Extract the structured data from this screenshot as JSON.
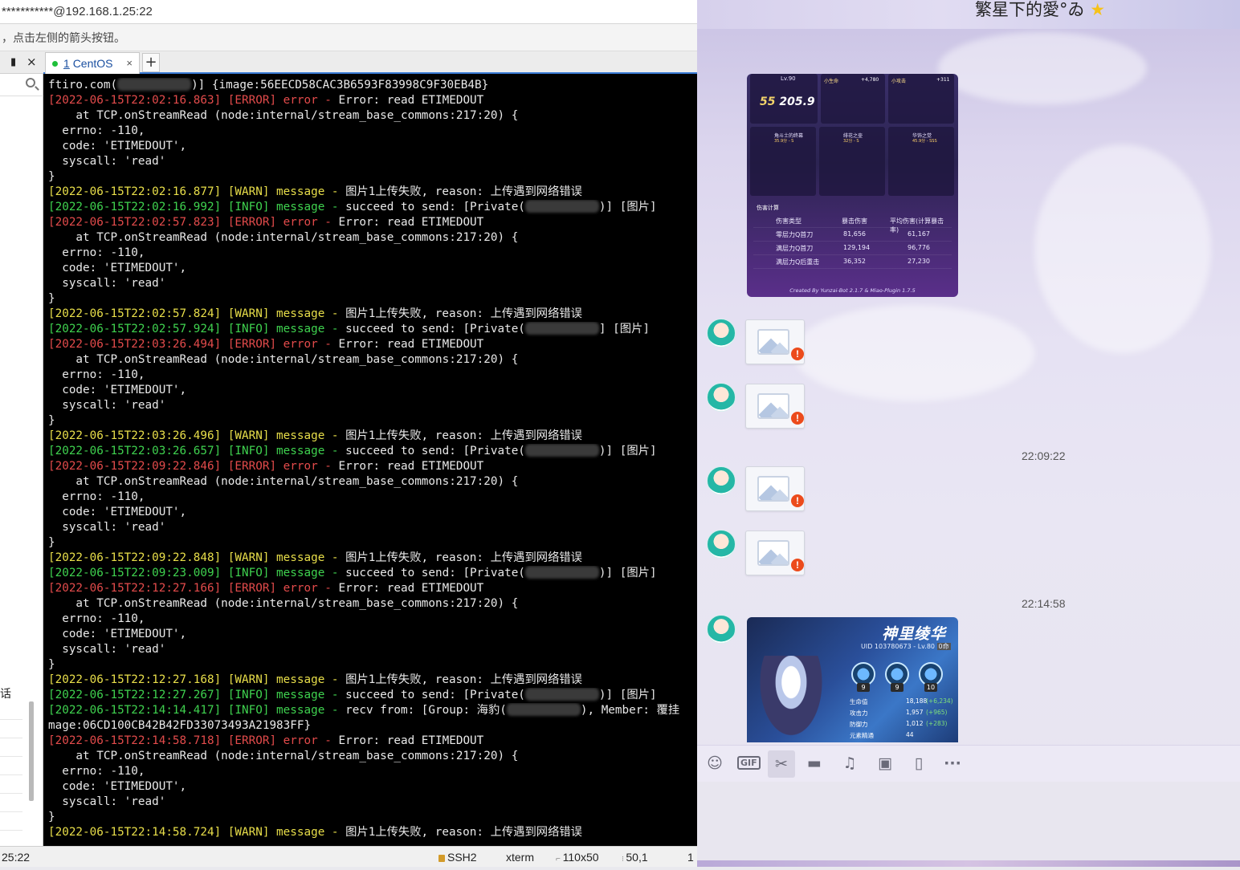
{
  "ssh": {
    "title": "***********@192.168.1.25:22",
    "tip": "，点击左侧的箭头按钮。",
    "panel": {
      "pin_icon": "pin-icon",
      "close_icon": "close-icon",
      "lower_label": "话"
    },
    "tab": {
      "number": "1",
      "label": "CentOS",
      "close": "×",
      "add": "+"
    },
    "statusbar": {
      "time": "25:22",
      "protocol": "SSH2",
      "term": "xterm",
      "size": "110x50",
      "cursor": "50,1",
      "extra": "1"
    }
  },
  "terminal": {
    "lines": [
      [
        {
          "t": "ftiro.com(",
          "c": "white"
        },
        {
          "blur": true
        },
        {
          "t": ")] {image:56EECD58CAC3B6593F83998C9F30EB4B}",
          "c": "white"
        }
      ],
      [
        {
          "t": "[2022-06-15T22:02:16.863] [ERROR] error - ",
          "c": "err"
        },
        {
          "t": "Error: read ETIMEDOUT",
          "c": "white"
        }
      ],
      [
        {
          "t": "    at TCP.onStreamRead (node:internal/stream_base_commons:217:20) {",
          "c": "white"
        }
      ],
      [
        {
          "t": "  errno: -110,",
          "c": "white"
        }
      ],
      [
        {
          "t": "  code: 'ETIMEDOUT',",
          "c": "white"
        }
      ],
      [
        {
          "t": "  syscall: 'read'",
          "c": "white"
        }
      ],
      [
        {
          "t": "}",
          "c": "white"
        }
      ],
      [
        {
          "t": "[2022-06-15T22:02:16.877] [WARN] message - ",
          "c": "warn"
        },
        {
          "t": "图片1上传失败, reason: 上传遇到网络错误",
          "c": "white"
        }
      ],
      [
        {
          "t": "[2022-06-15T22:02:16.992] [INFO] message - ",
          "c": "info"
        },
        {
          "t": "succeed to send: [Private(",
          "c": "white"
        },
        {
          "blur": true
        },
        {
          "t": ")] [图片]",
          "c": "white"
        }
      ],
      [
        {
          "t": "[2022-06-15T22:02:57.823] [ERROR] error - ",
          "c": "err"
        },
        {
          "t": "Error: read ETIMEDOUT",
          "c": "white"
        }
      ],
      [
        {
          "t": "    at TCP.onStreamRead (node:internal/stream_base_commons:217:20) {",
          "c": "white"
        }
      ],
      [
        {
          "t": "  errno: -110,",
          "c": "white"
        }
      ],
      [
        {
          "t": "  code: 'ETIMEDOUT',",
          "c": "white"
        }
      ],
      [
        {
          "t": "  syscall: 'read'",
          "c": "white"
        }
      ],
      [
        {
          "t": "}",
          "c": "white"
        }
      ],
      [
        {
          "t": "[2022-06-15T22:02:57.824] [WARN] message - ",
          "c": "warn"
        },
        {
          "t": "图片1上传失败, reason: 上传遇到网络错误",
          "c": "white"
        }
      ],
      [
        {
          "t": "[2022-06-15T22:02:57.924] [INFO] message - ",
          "c": "info"
        },
        {
          "t": "succeed to send: [Private(",
          "c": "white"
        },
        {
          "blur": true
        },
        {
          "t": "] [图片]",
          "c": "white"
        }
      ],
      [
        {
          "t": "[2022-06-15T22:03:26.494] [ERROR] error - ",
          "c": "err"
        },
        {
          "t": "Error: read ETIMEDOUT",
          "c": "white"
        }
      ],
      [
        {
          "t": "    at TCP.onStreamRead (node:internal/stream_base_commons:217:20) {",
          "c": "white"
        }
      ],
      [
        {
          "t": "  errno: -110,",
          "c": "white"
        }
      ],
      [
        {
          "t": "  code: 'ETIMEDOUT',",
          "c": "white"
        }
      ],
      [
        {
          "t": "  syscall: 'read'",
          "c": "white"
        }
      ],
      [
        {
          "t": "}",
          "c": "white"
        }
      ],
      [
        {
          "t": "[2022-06-15T22:03:26.496] [WARN] message - ",
          "c": "warn"
        },
        {
          "t": "图片1上传失败, reason: 上传遇到网络错误",
          "c": "white"
        }
      ],
      [
        {
          "t": "[2022-06-15T22:03:26.657] [INFO] message - ",
          "c": "info"
        },
        {
          "t": "succeed to send: [Private(",
          "c": "white"
        },
        {
          "blur": true
        },
        {
          "t": ")] [图片]",
          "c": "white"
        }
      ],
      [
        {
          "t": "[2022-06-15T22:09:22.846] [ERROR] error - ",
          "c": "err"
        },
        {
          "t": "Error: read ETIMEDOUT",
          "c": "white"
        }
      ],
      [
        {
          "t": "    at TCP.onStreamRead (node:internal/stream_base_commons:217:20) {",
          "c": "white"
        }
      ],
      [
        {
          "t": "  errno: -110,",
          "c": "white"
        }
      ],
      [
        {
          "t": "  code: 'ETIMEDOUT',",
          "c": "white"
        }
      ],
      [
        {
          "t": "  syscall: 'read'",
          "c": "white"
        }
      ],
      [
        {
          "t": "}",
          "c": "white"
        }
      ],
      [
        {
          "t": "[2022-06-15T22:09:22.848] [WARN] message - ",
          "c": "warn"
        },
        {
          "t": "图片1上传失败, reason: 上传遇到网络错误",
          "c": "white"
        }
      ],
      [
        {
          "t": "[2022-06-15T22:09:23.009] [INFO] message - ",
          "c": "info"
        },
        {
          "t": "succeed to send: [Private(",
          "c": "white"
        },
        {
          "blur": true
        },
        {
          "t": ")] [图片]",
          "c": "white"
        }
      ],
      [
        {
          "t": "[2022-06-15T22:12:27.166] [ERROR] error - ",
          "c": "err"
        },
        {
          "t": "Error: read ETIMEDOUT",
          "c": "white"
        }
      ],
      [
        {
          "t": "    at TCP.onStreamRead (node:internal/stream_base_commons:217:20) {",
          "c": "white"
        }
      ],
      [
        {
          "t": "  errno: -110,",
          "c": "white"
        }
      ],
      [
        {
          "t": "  code: 'ETIMEDOUT',",
          "c": "white"
        }
      ],
      [
        {
          "t": "  syscall: 'read'",
          "c": "white"
        }
      ],
      [
        {
          "t": "}",
          "c": "white"
        }
      ],
      [
        {
          "t": "[2022-06-15T22:12:27.168] [WARN] message - ",
          "c": "warn"
        },
        {
          "t": "图片1上传失败, reason: 上传遇到网络错误",
          "c": "white"
        }
      ],
      [
        {
          "t": "[2022-06-15T22:12:27.267] [INFO] message - ",
          "c": "info"
        },
        {
          "t": "succeed to send: [Private(",
          "c": "white"
        },
        {
          "blur": true
        },
        {
          "t": ")] [图片]",
          "c": "white"
        }
      ],
      [
        {
          "t": "[2022-06-15T22:14:14.417] [INFO] message - ",
          "c": "info"
        },
        {
          "t": "recv from: [Group: 海豹(",
          "c": "white"
        },
        {
          "blur": true
        },
        {
          "t": "), Member: 覆挂",
          "c": "white"
        }
      ],
      [
        {
          "t": "mage:06CD100CB42B42FD33073493A21983FF}",
          "c": "white"
        }
      ],
      [
        {
          "t": "[2022-06-15T22:14:58.718] [ERROR] error - ",
          "c": "err"
        },
        {
          "t": "Error: read ETIMEDOUT",
          "c": "white"
        }
      ],
      [
        {
          "t": "    at TCP.onStreamRead (node:internal/stream_base_commons:217:20) {",
          "c": "white"
        }
      ],
      [
        {
          "t": "  errno: -110,",
          "c": "white"
        }
      ],
      [
        {
          "t": "  code: 'ETIMEDOUT',",
          "c": "white"
        }
      ],
      [
        {
          "t": "  syscall: 'read'",
          "c": "white"
        }
      ],
      [
        {
          "t": "}",
          "c": "white"
        }
      ],
      [
        {
          "t": "[2022-06-15T22:14:58.724] [WARN] message - ",
          "c": "warn"
        },
        {
          "t": "图片1上传失败, reason: 上传遇到网络错误",
          "c": "white"
        }
      ]
    ]
  },
  "chat": {
    "title": "繁星下的愛°ゐ",
    "title_icon": "star-icon",
    "timestamps": [
      "22:09:22",
      "22:14:58"
    ],
    "failed_image_badge": "!",
    "stats_card": {
      "level": "Lv.90",
      "score": "55",
      "score_value": "205.9",
      "stats_headers": [
        "小生命",
        "+4,780",
        "小攻击",
        "+311"
      ],
      "weapons": [
        {
          "name": "角斗士的终幕",
          "score": "35.9分 - S"
        },
        {
          "name": "绯花之壶",
          "score": "32分 - S"
        },
        {
          "name": "华饰之觉",
          "score": "45.9分 - SSS"
        }
      ],
      "table_title": "伤害计算",
      "table_headers": [
        "伤害类型",
        "暴击伤害",
        "平均伤害(计算暴击率)"
      ],
      "table_rows": [
        [
          "零层力Q首刀",
          "81,656",
          "61,167"
        ],
        [
          "满层力Q首刀",
          "129,194",
          "96,776"
        ],
        [
          "满层力Q后重击",
          "36,352",
          "27,230"
        ]
      ],
      "footer": "Created By Yunzai-Bot 2.1.7 & Miao-Plugin 1.7.5"
    },
    "char_card": {
      "name": "神里绫华",
      "uid": "UID 103780673 - Lv.80",
      "tag": "0命",
      "talents": [
        "9",
        "9",
        "10"
      ],
      "stats": [
        {
          "k": "生命值",
          "v": "18,188",
          "p": "(+6,234)"
        },
        {
          "k": "攻击力",
          "v": "1,957",
          "p": "(+965)"
        },
        {
          "k": "防御力",
          "v": "1,012",
          "p": "(+283)"
        },
        {
          "k": "元素精通",
          "v": "44",
          "p": ""
        }
      ]
    },
    "toolbar": {
      "icons": [
        "emoji-icon",
        "gif-icon",
        "scissors-icon",
        "folder-icon",
        "music-icon",
        "image-icon",
        "shake-icon",
        "more-icon"
      ],
      "gif_label": "GIF",
      "more_label": "···"
    }
  }
}
